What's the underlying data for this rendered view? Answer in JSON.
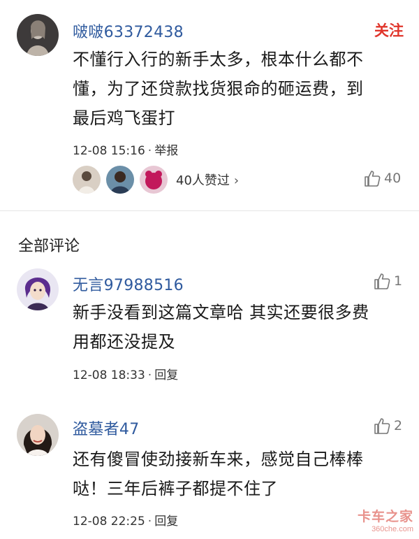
{
  "top_comment": {
    "username": "啵啵63372438",
    "follow_label": "关注",
    "content_lines": [
      "不懂行入行的新手太多，根本什么都不",
      "懂，为了还贷款找货狠命的砸运费，到",
      "最后鸡飞蛋打"
    ],
    "timestamp": "12-08 15:16",
    "separator": "·",
    "report_label": "举报",
    "likers_text": "40人赞过",
    "likers_chevron": "›",
    "like_count": "40"
  },
  "section": {
    "title": "全部评论"
  },
  "comments": [
    {
      "username": "无言97988516",
      "content_lines": [
        "新手没看到这篇文章哈 其实还要很多费",
        "用都还没提及"
      ],
      "timestamp": "12-08 18:33",
      "separator": "·",
      "reply_label": "回复",
      "like_count": "1"
    },
    {
      "username": "盗墓者47",
      "content_lines": [
        "还有傻冒使劲接新车来，感觉自己棒棒",
        "哒！三年后裤子都提不住了"
      ],
      "timestamp": "12-08 22:25",
      "separator": "·",
      "reply_label": "回复",
      "like_count": "2"
    }
  ],
  "watermark": {
    "main": "卡车之家",
    "sub": "360che.com"
  },
  "colors": {
    "username": "#2f5a9e",
    "follow": "#e0352b",
    "text": "#1a1a1a",
    "meta": "#333333",
    "like": "#777777",
    "divider": "#e6e6e6"
  }
}
